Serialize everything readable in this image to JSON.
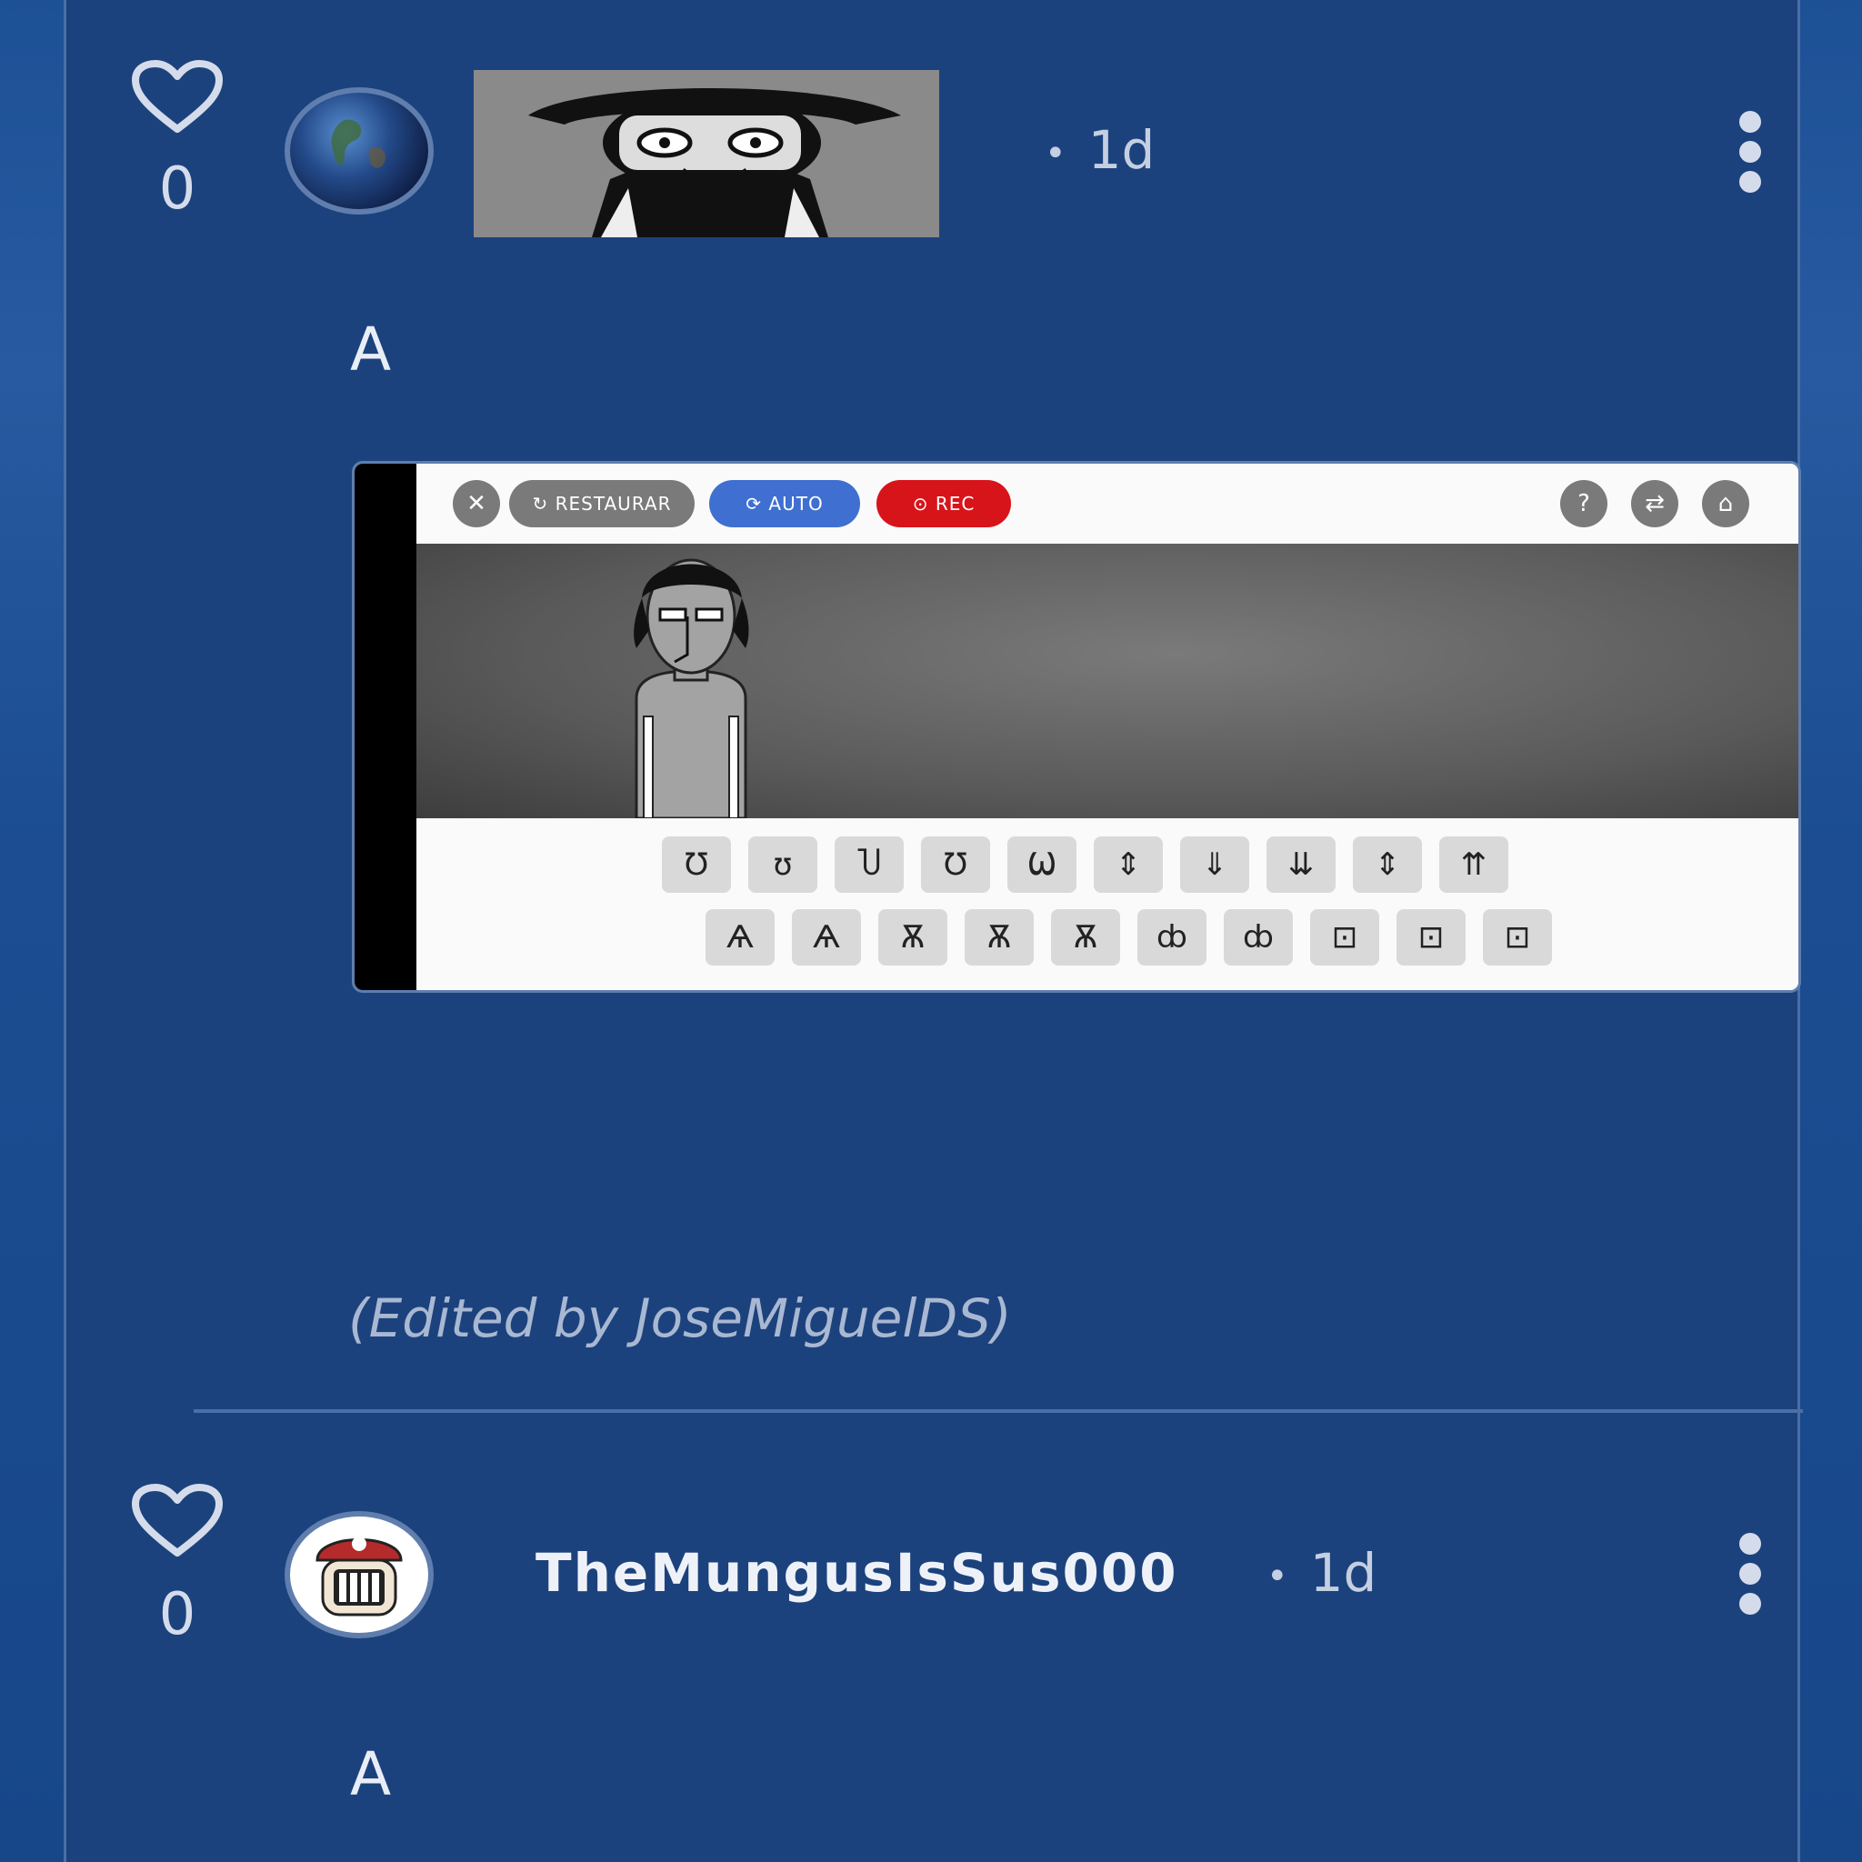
{
  "posts": [
    {
      "likes": "0",
      "timestamp": "1d",
      "dot": "•",
      "body": "A",
      "edited_note": "(Edited by JoseMiguelDS)",
      "embedded_screenshot": {
        "buttons": {
          "close": "✕",
          "restore": "RESTAURAR",
          "auto": "AUTO",
          "rec": "REC",
          "help": "?",
          "swap": "⇄",
          "home": "⌂"
        },
        "icons_row1": [
          "Ʊ",
          "ʊ",
          "Ⴎ",
          "Ʊ",
          "Ѡ",
          "⇕",
          "⇓",
          "⇊",
          "⇕",
          "⇈"
        ],
        "icons_row2": [
          "Ѧ",
          "Ѧ",
          "Ѫ",
          "Ѫ",
          "Ѫ",
          "ȸ",
          "ȸ",
          "⊡",
          "⊡",
          "⊡"
        ]
      }
    },
    {
      "likes": "0",
      "username": "TheMungusIsSus000",
      "timestamp": "1d",
      "dot": "•",
      "body": "A"
    }
  ],
  "icons": {
    "like": "heart-outline-icon",
    "menu": "kebab-menu-icon"
  },
  "colors": {
    "panel": "#1c427d",
    "rec": "#d8141b",
    "auto": "#3f6fd0"
  }
}
